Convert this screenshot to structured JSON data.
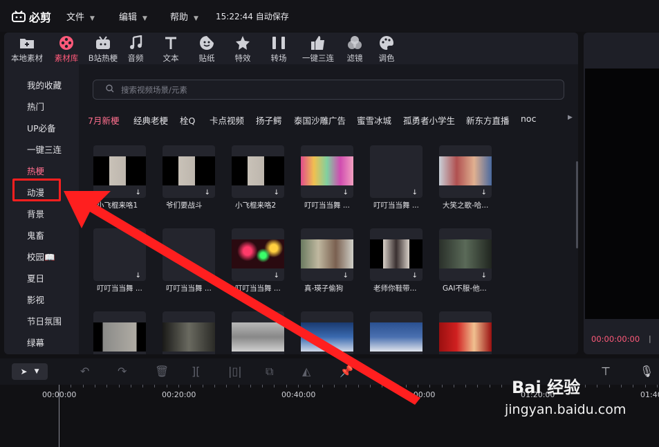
{
  "app": {
    "name": "必剪"
  },
  "menus": [
    {
      "label": "文件"
    },
    {
      "label": "编辑"
    },
    {
      "label": "帮助"
    }
  ],
  "autosave": "15:22:44 自动保存",
  "tabs": [
    {
      "label": "本地素材",
      "icon": "folder-icon"
    },
    {
      "label": "素材库",
      "icon": "film-reel-icon"
    },
    {
      "label": "B站热梗",
      "icon": "bilibili-tv-icon"
    },
    {
      "label": "音频",
      "icon": "music-note-icon"
    },
    {
      "label": "文本",
      "icon": "text-icon"
    },
    {
      "label": "贴纸",
      "icon": "sticker-icon"
    },
    {
      "label": "特效",
      "icon": "sparkle-star-icon"
    },
    {
      "label": "转场",
      "icon": "transition-icon"
    },
    {
      "label": "一键三连",
      "icon": "thumbs-up-icon"
    },
    {
      "label": "滤镜",
      "icon": "filter-circles-icon"
    },
    {
      "label": "调色",
      "icon": "palette-icon"
    }
  ],
  "sidebar": {
    "items": [
      "我的收藏",
      "热门",
      "UP必备",
      "一键三连",
      "热梗",
      "动漫",
      "背景",
      "鬼畜",
      "校园📖",
      "夏日",
      "影视",
      "节日氛围",
      "绿幕"
    ]
  },
  "search": {
    "placeholder": "搜索视频场景/元素"
  },
  "categories": [
    "7月新梗",
    "经典老梗",
    "栓Q",
    "卡点视频",
    "扬子鳄",
    "泰国沙雕广告",
    "蜜雪冰城",
    "孤勇者小学生",
    "新东方直播",
    "noc"
  ],
  "cards": [
    {
      "caption": "小飞棍来咯1",
      "thumb": "person-b"
    },
    {
      "caption": "爷们要战斗",
      "thumb": "person-b"
    },
    {
      "caption": "小飞棍来咯2",
      "thumb": "person-b"
    },
    {
      "caption": "叮叮当当舞 ...",
      "thumb": "colorful"
    },
    {
      "caption": "叮叮当当舞 ...",
      "thumb": "dark"
    },
    {
      "caption": "大笑之歌-哈...",
      "thumb": "people"
    },
    {
      "caption": "叮叮当当舞 ...",
      "thumb": "dark"
    },
    {
      "caption": "叮叮当当舞 ...",
      "thumb": "dark"
    },
    {
      "caption": "叮叮当当舞 ...",
      "thumb": "lights"
    },
    {
      "caption": "真-瑛子偷狗",
      "thumb": "street"
    },
    {
      "caption": "老师你鞋带...",
      "thumb": "portrait"
    },
    {
      "caption": "GAI不服-他...",
      "thumb": "dim"
    },
    {
      "caption": "",
      "thumb": "car"
    },
    {
      "caption": "",
      "thumb": "archer"
    },
    {
      "caption": "",
      "thumb": "eagle"
    },
    {
      "caption": "",
      "thumb": "news"
    },
    {
      "caption": "",
      "thumb": "news2"
    },
    {
      "caption": "",
      "thumb": "red"
    }
  ],
  "preview": {
    "timecode": "00:00:00:00",
    "separator": "|"
  },
  "ruler": [
    "00:00:00",
    "00:20:00",
    "00:40:00",
    "01:00:00",
    "01:20:00",
    "01:40"
  ],
  "watermark": {
    "line1": "Bai 经验",
    "line2": "jingyan.baidu.com"
  },
  "colors": {
    "accent": "#ff5a7a",
    "annotation": "#ff1f1f",
    "background": "#111114",
    "panel": "#1e1f27"
  }
}
